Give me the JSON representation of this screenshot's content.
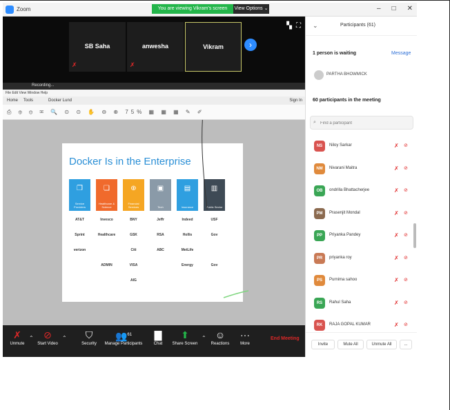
{
  "app": {
    "title": "Zoom",
    "window_controls": [
      "–",
      "□",
      "✕"
    ]
  },
  "banner": {
    "viewing_text": "You are viewing Vikram's screen",
    "view_options": "View Options ⌄"
  },
  "gallery": {
    "tiles": [
      {
        "name": "SB Saha",
        "muted": true
      },
      {
        "name": "anwesha",
        "muted": true
      },
      {
        "name": "Vikram",
        "muted": false,
        "active": true
      }
    ],
    "next_icon": "chevron-right-icon"
  },
  "shared_screen": {
    "recording_label": "Recording...",
    "menu": "File  Edit  View  Window  Help",
    "tabs": [
      "Home",
      "Tools",
      "Docker Lund"
    ],
    "sign_in": "Sign In",
    "toolbar_glyphs": "⎙ ⊕ ⊖ ✉ 🔍 ⊙ ⊙ ✋ ⊖ ⊕ 75% ▦ ▦ ▦ ✎ ✐",
    "slide": {
      "title": "Docker Is in the Enterprise",
      "categories": [
        {
          "label": "Service Providers",
          "color": "#2f9fe0",
          "icon": "❐"
        },
        {
          "label": "Healthcare & Science",
          "color": "#f06a2c",
          "icon": "❏"
        },
        {
          "label": "Financial Services",
          "color": "#f5a623",
          "icon": "⊕"
        },
        {
          "label": "Tech",
          "color": "#8a9aa8",
          "icon": "▣"
        },
        {
          "label": "Insurance",
          "color": "#2f9fe0",
          "icon": "▤"
        },
        {
          "label": "Public Sector",
          "color": "#3e4a55",
          "icon": "▥"
        }
      ],
      "logos": [
        [
          "AT&T",
          "Sprint",
          "verizon"
        ],
        [
          "Invesco",
          "Healthcare",
          "",
          "ADMIN"
        ],
        [
          "BNY",
          "GSK",
          "Citi",
          "VISA",
          "AIG"
        ],
        [
          "Jeffr",
          "RSA",
          "ABC",
          "",
          ""
        ],
        [
          "Indeed",
          "Hollis",
          "MetLife",
          "Energy"
        ],
        [
          "USF",
          "Gov",
          "",
          "Gov"
        ]
      ]
    }
  },
  "toolbar": {
    "unmute": "Unmute",
    "start_video": "Start Video",
    "security": "Security",
    "manage_participants": "Manage Participants",
    "participants_count": "61",
    "chat": "Chat",
    "share_screen": "Share Screen",
    "reactions": "Reactions",
    "more": "More",
    "end_meeting": "End Meeting"
  },
  "panel": {
    "title": "Participants (61)",
    "waiting_text": "1 person is waiting",
    "message_link": "Message",
    "waiting_person": "PARTHA BHOWMICK",
    "in_meeting_text": "60 participants in the meeting",
    "search_placeholder": "Find a participant",
    "participants": [
      {
        "initials": "NS",
        "name": "Niloy Sarkar",
        "color": "#d9534f"
      },
      {
        "initials": "NM",
        "name": "Nivarani Maitra",
        "color": "#e08a3c"
      },
      {
        "initials": "OB",
        "name": "ondrilla Bhattacherjee",
        "color": "#3aa655"
      },
      {
        "initials": "PM",
        "name": "Prasenjit Mondal",
        "color": "#8b6a4f"
      },
      {
        "initials": "PP",
        "name": "Priyanka Pandey",
        "color": "#3aa655"
      },
      {
        "initials": "PR",
        "name": "priyanka roy",
        "color": "#c97a55"
      },
      {
        "initials": "PS",
        "name": "Purnima sahoo",
        "color": "#e08a3c"
      },
      {
        "initials": "RS",
        "name": "Rahul Saha",
        "color": "#3aa655"
      },
      {
        "initials": "RK",
        "name": "RAJA GOPAL KUMAR",
        "color": "#d9534f"
      }
    ],
    "footer": {
      "invite": "Invite",
      "mute_all": "Mute All",
      "unmute_all": "Unmute All",
      "more": "..."
    }
  }
}
